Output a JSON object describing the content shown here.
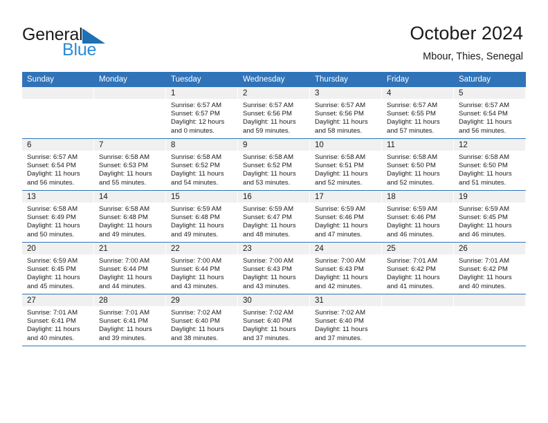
{
  "brand": {
    "name_part1": "General",
    "name_part2": "Blue",
    "triangle_color": "#1f6fb5",
    "blue_text_color": "#2b8ad6"
  },
  "header": {
    "title": "October 2024",
    "subtitle": "Mbour, Thies, Senegal"
  },
  "theme": {
    "header_blue": "#3073b8",
    "row_separator_blue": "#3073b8",
    "daynum_band_gray": "#f0f0f0",
    "text_color": "#1a1a1a",
    "background": "#ffffff"
  },
  "weekdays": [
    "Sunday",
    "Monday",
    "Tuesday",
    "Wednesday",
    "Thursday",
    "Friday",
    "Saturday"
  ],
  "labels": {
    "sunrise_prefix": "Sunrise:",
    "sunset_prefix": "Sunset:",
    "daylight_prefix": "Daylight:"
  },
  "weeks": [
    [
      {
        "empty": true
      },
      {
        "empty": true
      },
      {
        "day": "1",
        "sunrise": "Sunrise: 6:57 AM",
        "sunset": "Sunset: 6:57 PM",
        "daylight": "Daylight: 12 hours and 0 minutes."
      },
      {
        "day": "2",
        "sunrise": "Sunrise: 6:57 AM",
        "sunset": "Sunset: 6:56 PM",
        "daylight": "Daylight: 11 hours and 59 minutes."
      },
      {
        "day": "3",
        "sunrise": "Sunrise: 6:57 AM",
        "sunset": "Sunset: 6:56 PM",
        "daylight": "Daylight: 11 hours and 58 minutes."
      },
      {
        "day": "4",
        "sunrise": "Sunrise: 6:57 AM",
        "sunset": "Sunset: 6:55 PM",
        "daylight": "Daylight: 11 hours and 57 minutes."
      },
      {
        "day": "5",
        "sunrise": "Sunrise: 6:57 AM",
        "sunset": "Sunset: 6:54 PM",
        "daylight": "Daylight: 11 hours and 56 minutes."
      }
    ],
    [
      {
        "day": "6",
        "sunrise": "Sunrise: 6:57 AM",
        "sunset": "Sunset: 6:54 PM",
        "daylight": "Daylight: 11 hours and 56 minutes."
      },
      {
        "day": "7",
        "sunrise": "Sunrise: 6:58 AM",
        "sunset": "Sunset: 6:53 PM",
        "daylight": "Daylight: 11 hours and 55 minutes."
      },
      {
        "day": "8",
        "sunrise": "Sunrise: 6:58 AM",
        "sunset": "Sunset: 6:52 PM",
        "daylight": "Daylight: 11 hours and 54 minutes."
      },
      {
        "day": "9",
        "sunrise": "Sunrise: 6:58 AM",
        "sunset": "Sunset: 6:52 PM",
        "daylight": "Daylight: 11 hours and 53 minutes."
      },
      {
        "day": "10",
        "sunrise": "Sunrise: 6:58 AM",
        "sunset": "Sunset: 6:51 PM",
        "daylight": "Daylight: 11 hours and 52 minutes."
      },
      {
        "day": "11",
        "sunrise": "Sunrise: 6:58 AM",
        "sunset": "Sunset: 6:50 PM",
        "daylight": "Daylight: 11 hours and 52 minutes."
      },
      {
        "day": "12",
        "sunrise": "Sunrise: 6:58 AM",
        "sunset": "Sunset: 6:50 PM",
        "daylight": "Daylight: 11 hours and 51 minutes."
      }
    ],
    [
      {
        "day": "13",
        "sunrise": "Sunrise: 6:58 AM",
        "sunset": "Sunset: 6:49 PM",
        "daylight": "Daylight: 11 hours and 50 minutes."
      },
      {
        "day": "14",
        "sunrise": "Sunrise: 6:58 AM",
        "sunset": "Sunset: 6:48 PM",
        "daylight": "Daylight: 11 hours and 49 minutes."
      },
      {
        "day": "15",
        "sunrise": "Sunrise: 6:59 AM",
        "sunset": "Sunset: 6:48 PM",
        "daylight": "Daylight: 11 hours and 49 minutes."
      },
      {
        "day": "16",
        "sunrise": "Sunrise: 6:59 AM",
        "sunset": "Sunset: 6:47 PM",
        "daylight": "Daylight: 11 hours and 48 minutes."
      },
      {
        "day": "17",
        "sunrise": "Sunrise: 6:59 AM",
        "sunset": "Sunset: 6:46 PM",
        "daylight": "Daylight: 11 hours and 47 minutes."
      },
      {
        "day": "18",
        "sunrise": "Sunrise: 6:59 AM",
        "sunset": "Sunset: 6:46 PM",
        "daylight": "Daylight: 11 hours and 46 minutes."
      },
      {
        "day": "19",
        "sunrise": "Sunrise: 6:59 AM",
        "sunset": "Sunset: 6:45 PM",
        "daylight": "Daylight: 11 hours and 46 minutes."
      }
    ],
    [
      {
        "day": "20",
        "sunrise": "Sunrise: 6:59 AM",
        "sunset": "Sunset: 6:45 PM",
        "daylight": "Daylight: 11 hours and 45 minutes."
      },
      {
        "day": "21",
        "sunrise": "Sunrise: 7:00 AM",
        "sunset": "Sunset: 6:44 PM",
        "daylight": "Daylight: 11 hours and 44 minutes."
      },
      {
        "day": "22",
        "sunrise": "Sunrise: 7:00 AM",
        "sunset": "Sunset: 6:44 PM",
        "daylight": "Daylight: 11 hours and 43 minutes."
      },
      {
        "day": "23",
        "sunrise": "Sunrise: 7:00 AM",
        "sunset": "Sunset: 6:43 PM",
        "daylight": "Daylight: 11 hours and 43 minutes."
      },
      {
        "day": "24",
        "sunrise": "Sunrise: 7:00 AM",
        "sunset": "Sunset: 6:43 PM",
        "daylight": "Daylight: 11 hours and 42 minutes."
      },
      {
        "day": "25",
        "sunrise": "Sunrise: 7:01 AM",
        "sunset": "Sunset: 6:42 PM",
        "daylight": "Daylight: 11 hours and 41 minutes."
      },
      {
        "day": "26",
        "sunrise": "Sunrise: 7:01 AM",
        "sunset": "Sunset: 6:42 PM",
        "daylight": "Daylight: 11 hours and 40 minutes."
      }
    ],
    [
      {
        "day": "27",
        "sunrise": "Sunrise: 7:01 AM",
        "sunset": "Sunset: 6:41 PM",
        "daylight": "Daylight: 11 hours and 40 minutes."
      },
      {
        "day": "28",
        "sunrise": "Sunrise: 7:01 AM",
        "sunset": "Sunset: 6:41 PM",
        "daylight": "Daylight: 11 hours and 39 minutes."
      },
      {
        "day": "29",
        "sunrise": "Sunrise: 7:02 AM",
        "sunset": "Sunset: 6:40 PM",
        "daylight": "Daylight: 11 hours and 38 minutes."
      },
      {
        "day": "30",
        "sunrise": "Sunrise: 7:02 AM",
        "sunset": "Sunset: 6:40 PM",
        "daylight": "Daylight: 11 hours and 37 minutes."
      },
      {
        "day": "31",
        "sunrise": "Sunrise: 7:02 AM",
        "sunset": "Sunset: 6:40 PM",
        "daylight": "Daylight: 11 hours and 37 minutes."
      },
      {
        "empty": true
      },
      {
        "empty": true
      }
    ]
  ]
}
